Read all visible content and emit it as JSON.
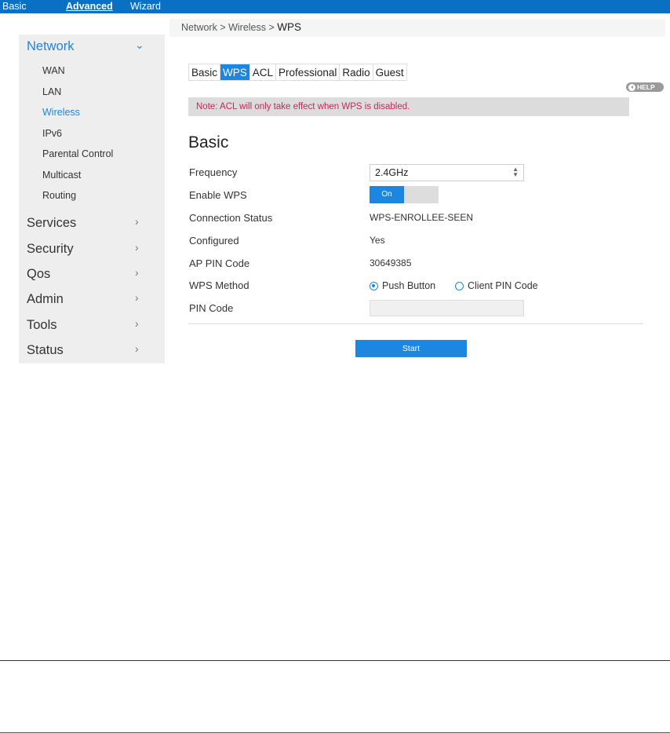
{
  "topnav": {
    "basic": "Basic",
    "advanced": "Advanced",
    "wizard": "Wizard"
  },
  "sidebar": {
    "network": "Network",
    "subitems": [
      "WAN",
      "LAN",
      "Wireless",
      "IPv6",
      "Parental Control",
      "Multicast",
      "Routing"
    ],
    "sections": [
      "Services",
      "Security",
      "Qos",
      "Admin",
      "Tools",
      "Status"
    ],
    "chevron_down": "⌄",
    "chevron_right": "›"
  },
  "breadcrumb": {
    "path": "Network > Wireless > ",
    "current": "WPS"
  },
  "tabs": [
    "Basic",
    "WPS",
    "ACL",
    "Professional",
    "Radio",
    "Guest"
  ],
  "help": "HELP",
  "note": "Note: ACL will only take effect when WPS is disabled.",
  "section_title": "Basic",
  "form": {
    "frequency_label": "Frequency",
    "frequency_value": "2.4GHz",
    "enable_wps_label": "Enable WPS",
    "enable_wps_value": "On",
    "connection_status_label": "Connection Status",
    "connection_status_value": "WPS-ENROLLEE-SEEN",
    "configured_label": "Configured",
    "configured_value": "Yes",
    "ap_pin_label": "AP PIN Code",
    "ap_pin_value": "30649385",
    "wps_method_label": "WPS Method",
    "wps_method_options": [
      "Push Button",
      "Client PIN Code"
    ],
    "wps_method_selected": "Push Button",
    "pin_code_label": "PIN Code",
    "pin_code_value": ""
  },
  "start_button": "Start",
  "colors": {
    "brand_blue": "#0a70c4",
    "accent_blue": "#1c86e0",
    "note_text": "#c8245e"
  }
}
